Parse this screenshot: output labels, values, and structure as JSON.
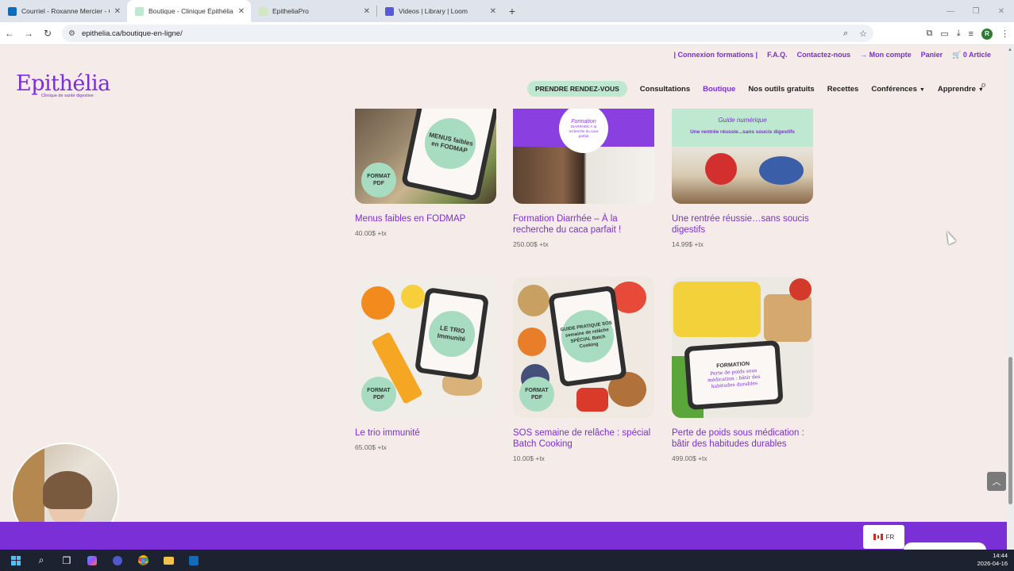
{
  "browser": {
    "tabs": [
      {
        "title": "Courriel - Roxanne Mercier - Ou",
        "favicon_color": "#0f6cbd",
        "active": false
      },
      {
        "title": "Boutique - Clinique Épithélia",
        "favicon_color": "#bfe8d0",
        "active": true
      },
      {
        "title": "EpitheliaPro",
        "favicon_color": "#cfe8c0",
        "active": false
      },
      {
        "title": "Videos | Library | Loom",
        "favicon_color": "#565adb",
        "active": false
      }
    ],
    "new_tab": "+",
    "url": "epithelia.ca/boutique-en-ligne/",
    "profile_initial": "R"
  },
  "site": {
    "top_links": [
      "| Connexion formations |",
      "F.A.Q.",
      "Contactez-nous",
      "→ Mon compte",
      "Panier",
      "🛒  0 Article"
    ],
    "logo": {
      "word": "Epithélia",
      "tagline": "Clinique de santé digestive"
    },
    "cta": "PRENDRE RENDEZ-VOUS",
    "nav": [
      {
        "label": "Consultations",
        "current": false,
        "dropdown": false
      },
      {
        "label": "Boutique",
        "current": true,
        "dropdown": false
      },
      {
        "label": "Nos outils gratuits",
        "current": false,
        "dropdown": false
      },
      {
        "label": "Recettes",
        "current": false,
        "dropdown": false
      },
      {
        "label": "Conférences",
        "current": false,
        "dropdown": true
      },
      {
        "label": "Apprendre",
        "current": false,
        "dropdown": true
      }
    ],
    "accent": "#7b2fd6",
    "mint": "#a8dcc0"
  },
  "products": [
    {
      "name": "Menus faibles en FODMAP",
      "price": "40.00$ +tx",
      "badge": "FORMAT PDF",
      "screen_text": "MENUS faibles en FODMAP"
    },
    {
      "name": "Formation Diarrhée – À la recherche du caca parfait !",
      "price": "250.00$ +tx",
      "banner_text": "Formation",
      "circle_text": "DIARRHÉE À la recherche du caca parfait"
    },
    {
      "name": "Une rentrée réussie…sans soucis digestifs",
      "price": "14.99$ +tx",
      "banner_text": "Guide numérique",
      "banner_sub": "Une rentrée réussie...sans soucis digestifs"
    },
    {
      "name": "Le trio immunité",
      "price": "65.00$ +tx",
      "badge": "FORMAT PDF",
      "screen_text": "LE TRIO Immunité"
    },
    {
      "name": "SOS semaine de relâche : spécial Batch Cooking",
      "price": "10.00$ +tx",
      "badge": "FORMAT PDF",
      "screen_text": "GUIDE PRATIQUE SOS semaine de relâche SPÉCIAL Batch Cooking"
    },
    {
      "name": "Perte de poids sous médication : bâtir des habitudes durables",
      "price": "499.00$ +tx",
      "screen_title": "FORMATION",
      "screen_text": "Perte de poids sous médication : bâtir des habitudes durables"
    }
  ],
  "language": "FR",
  "taskbar": {
    "time": "14:44",
    "date": "2026-04-16"
  }
}
